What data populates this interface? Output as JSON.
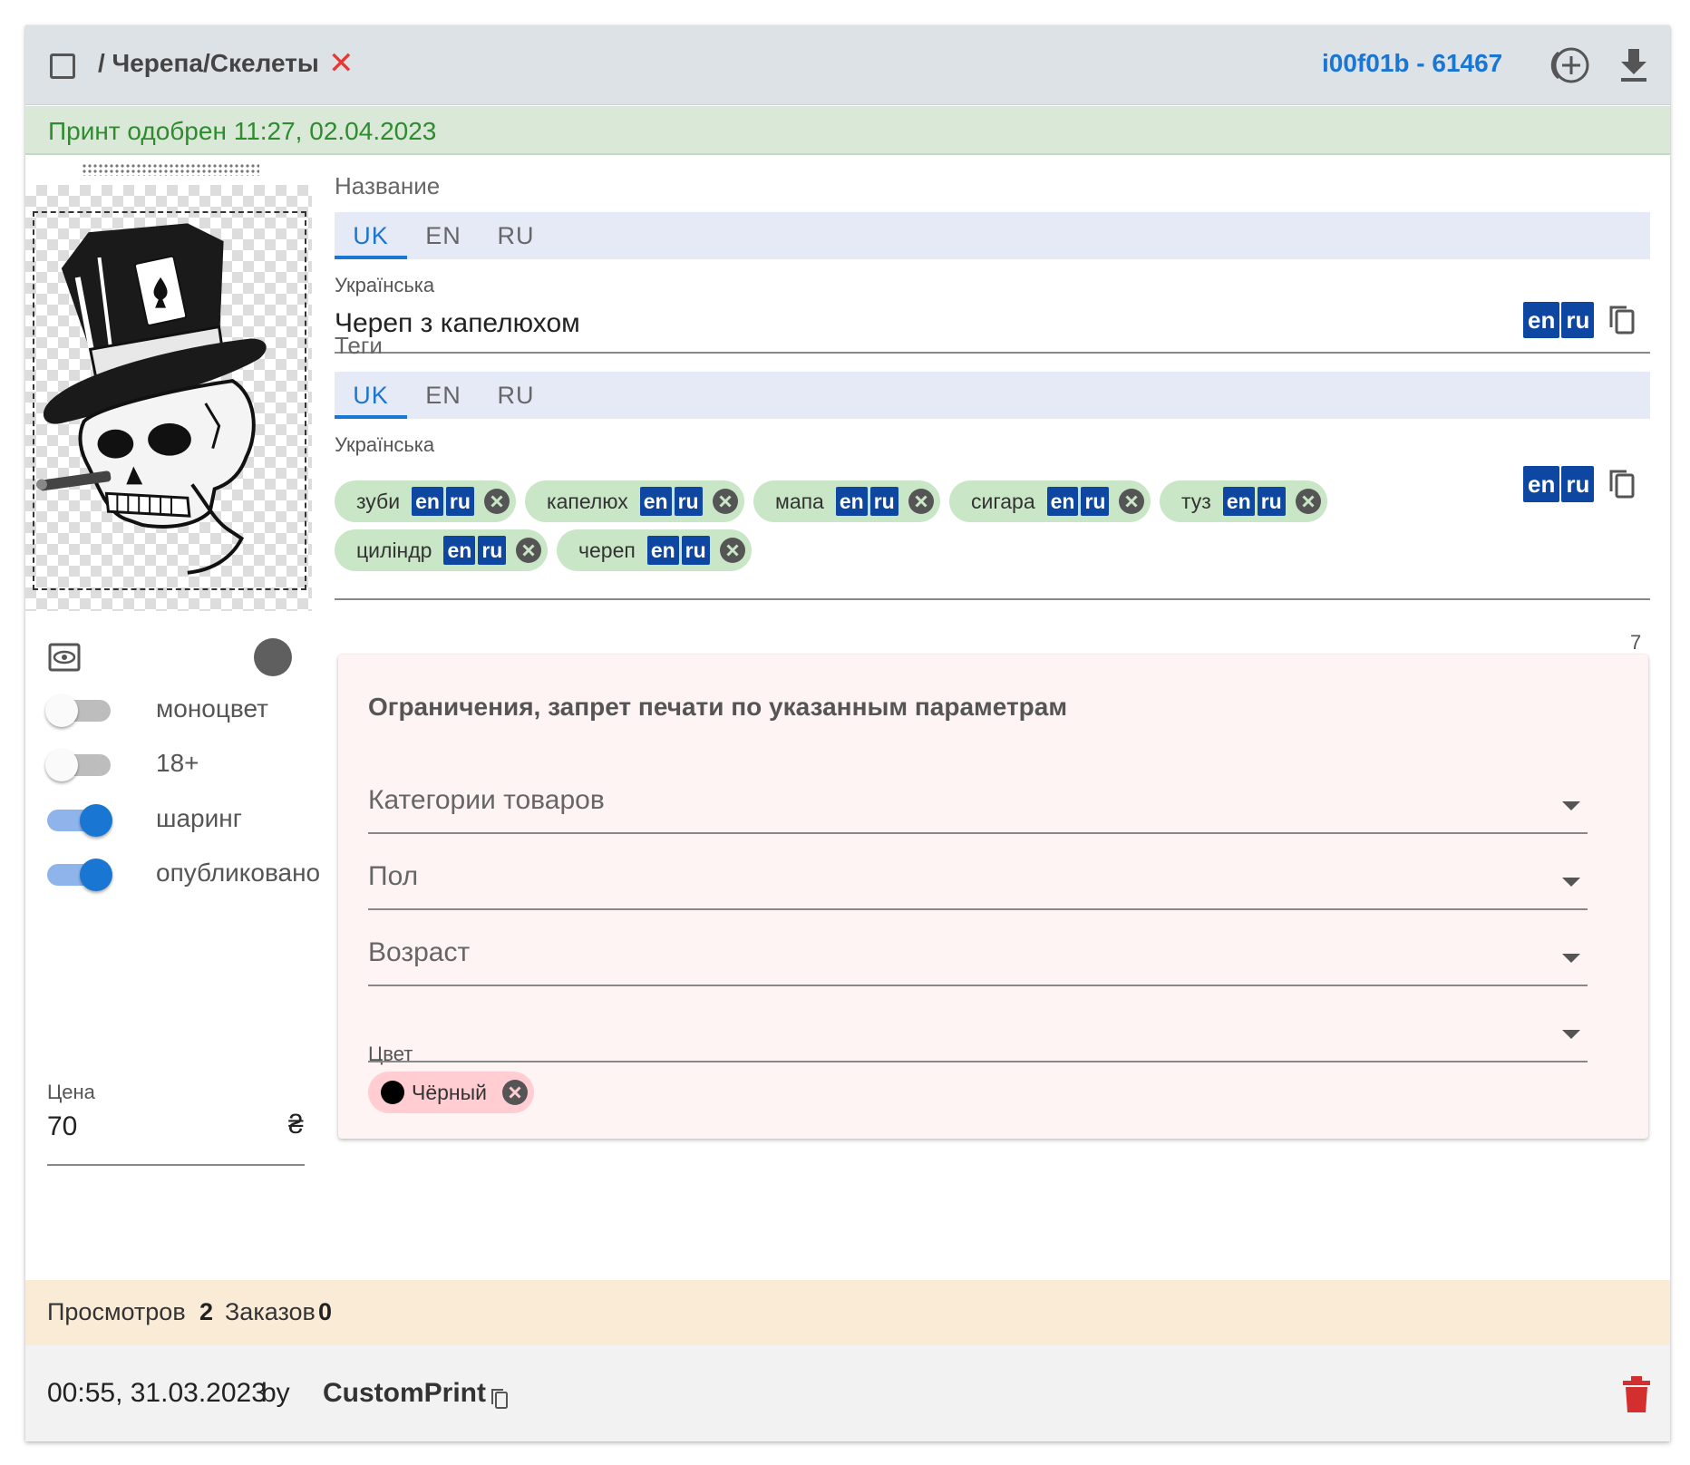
{
  "header": {
    "breadcrumb": "/ Черепа/Скелеты",
    "remove_symbol": "✕",
    "item_id": "i00f01b - 61467"
  },
  "status": {
    "approved_text": "Принт одобрен 11:27, 02.04.2023"
  },
  "left_panel": {
    "image_alt_subject": "skull-with-top-hat",
    "toggles": [
      {
        "label": "моноцвет",
        "on": false
      },
      {
        "label": "18+",
        "on": false
      },
      {
        "label": "шаринг",
        "on": true
      },
      {
        "label": "опубликовано",
        "on": true
      }
    ],
    "price": {
      "label": "Цена",
      "value": "70",
      "currency": "₴"
    }
  },
  "name_section": {
    "label": "Название",
    "tabs": [
      "UK",
      "EN",
      "RU"
    ],
    "active_tab": "UK",
    "field_label": "Українська",
    "value": "Череп з капелюхом",
    "translate_buttons": [
      "en",
      "ru"
    ]
  },
  "tags_section": {
    "label": "Теги",
    "tabs": [
      "UK",
      "EN",
      "RU"
    ],
    "active_tab": "UK",
    "field_label": "Українська",
    "chip_buttons": [
      "en",
      "ru"
    ],
    "tags": [
      "зуби",
      "капелюх",
      "мапа",
      "сигара",
      "туз",
      "циліндр",
      "череп"
    ],
    "translate_buttons": [
      "en",
      "ru"
    ],
    "counter": "7"
  },
  "restrictions": {
    "title": "Ограничения, запрет печати по указанным параметрам",
    "selects": [
      {
        "label": "Категории товаров"
      },
      {
        "label": "Пол"
      },
      {
        "label": "Возраст"
      }
    ],
    "color": {
      "label": "Цвет",
      "chip": "Чёрный",
      "chip_color": "#000000"
    }
  },
  "stats": {
    "views_label": "Просмотров",
    "views": "2",
    "orders_label": "Заказов",
    "orders": "0"
  },
  "footer": {
    "date": "00:55, 31.03.2023",
    "by": "by",
    "author": "CustomPrint"
  },
  "colors": {
    "accent": "#1976d2",
    "approved_bg": "#dae8d8",
    "approved_text": "#2e8b2e",
    "chip_bg": "#c9e6c6",
    "badge_bg": "#0d47a1",
    "danger": "#d32f2f",
    "restr_bg": "#fef4f3"
  }
}
